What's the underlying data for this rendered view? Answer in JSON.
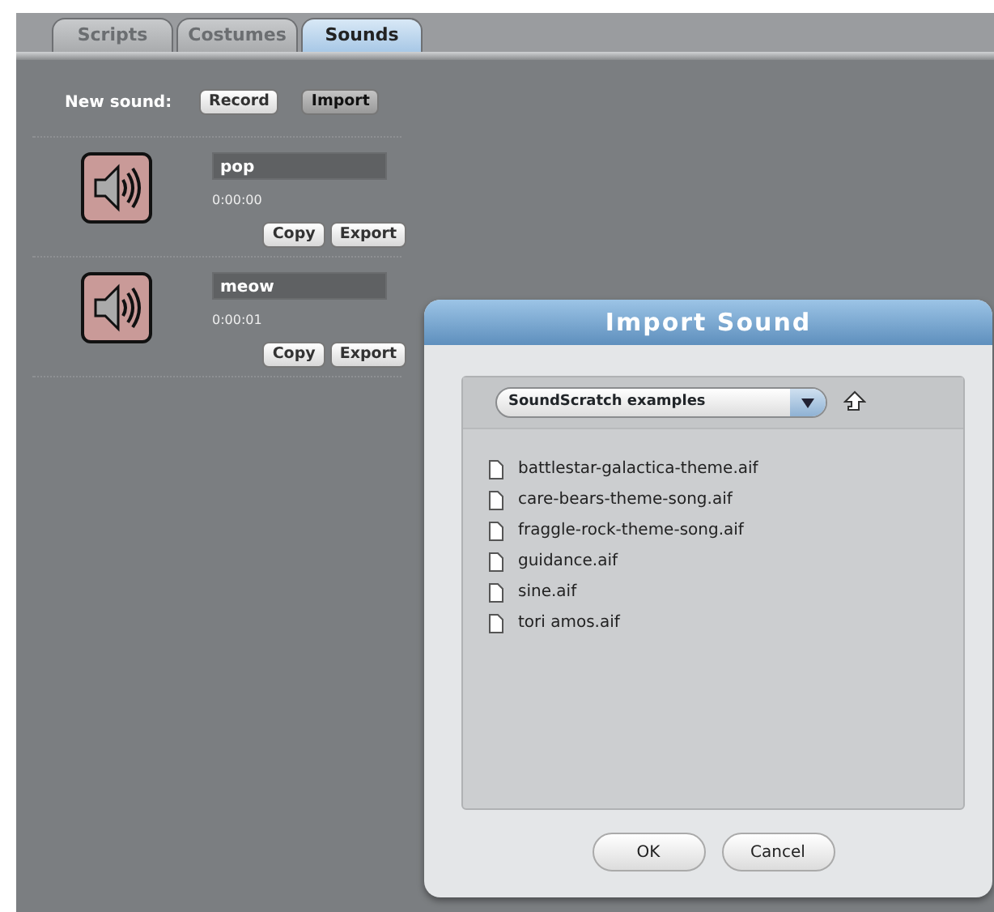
{
  "tabs": [
    {
      "label": "Scripts",
      "selected": false
    },
    {
      "label": "Costumes",
      "selected": false
    },
    {
      "label": "Sounds",
      "selected": true
    }
  ],
  "new_sound": {
    "label": "New sound:",
    "buttons": [
      {
        "label": "Record",
        "pressed": false
      },
      {
        "label": "Import",
        "pressed": true
      }
    ]
  },
  "sounds": [
    {
      "name": "pop",
      "duration": "0:00:00",
      "buttons": [
        "Copy",
        "Export"
      ]
    },
    {
      "name": "meow",
      "duration": "0:00:01",
      "buttons": [
        "Copy",
        "Export"
      ]
    }
  ],
  "dialog": {
    "title": "Import Sound",
    "folder": "SoundScratch examples",
    "files": [
      "battlestar-galactica-theme.aif",
      "care-bears-theme-song.aif",
      "fraggle-rock-theme-song.aif",
      "guidance.aif",
      "sine.aif",
      "tori amos.aif"
    ],
    "buttons": [
      "OK",
      "Cancel"
    ]
  }
}
